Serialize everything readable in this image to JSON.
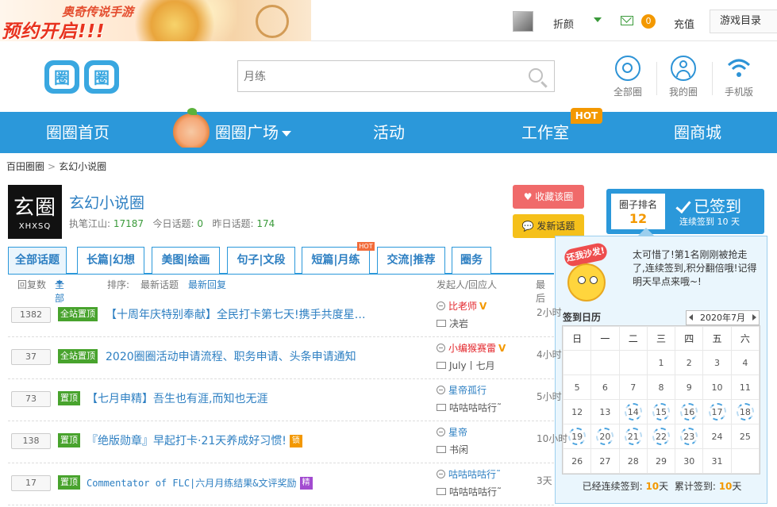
{
  "banner": {
    "line1": "奥奇传说手游",
    "line2": "预约开启!!!"
  },
  "topbar": {
    "username": "折颜",
    "mail_count": "0",
    "recharge": "充值",
    "games_menu": "游戏目录"
  },
  "header": {
    "logo": "圈圈",
    "search_placeholder": "月练",
    "icons": [
      {
        "label": "全部圈",
        "icon": "circle-icon"
      },
      {
        "label": "我的圈",
        "icon": "user-icon"
      },
      {
        "label": "手机版",
        "icon": "wifi-icon"
      }
    ]
  },
  "nav": {
    "items": [
      "圈圈首页",
      "圈圈广场",
      "活动",
      "工作室",
      "圈商城"
    ],
    "hot": "HOT"
  },
  "breadcrumb": [
    "百田圈圈",
    "玄幻小说圈"
  ],
  "circle": {
    "logo_char": "玄圈",
    "logo_en": "XHXSQ",
    "name": "玄幻小说圈",
    "stat1_label": "执笔江山:",
    "stat1_value": "17187",
    "stat2_label": "今日话题:",
    "stat2_value": "0",
    "stat3_label": "昨日话题:",
    "stat3_value": "174",
    "fav_btn": "收藏该圈",
    "post_btn": "发新话题"
  },
  "rank": {
    "title": "圈子排名",
    "value": "12",
    "signed": "已签到",
    "streak": "连续签到  10 天"
  },
  "popup": {
    "sofa_tag": "还我沙发!",
    "message": "太可惜了!第1名刚刚被抢走了,连续签到,积分翻倍哦!记得明天早点来哦~!",
    "cal_title": "签到日历",
    "month": "2020年7月",
    "weekdays": [
      "日",
      "一",
      "二",
      "三",
      "四",
      "五",
      "六"
    ],
    "weeks": [
      [
        "",
        "",
        "",
        "1",
        "2",
        "3",
        "4"
      ],
      [
        "5",
        "6",
        "7",
        "8",
        "9",
        "10",
        "11"
      ],
      [
        "12",
        "13",
        "14",
        "15",
        "16",
        "17",
        "18"
      ],
      [
        "19",
        "20",
        "21",
        "22",
        "23",
        "24",
        "25"
      ],
      [
        "26",
        "27",
        "28",
        "29",
        "30",
        "31",
        ""
      ]
    ],
    "signed_days": [
      "14",
      "15",
      "16",
      "17",
      "18",
      "19",
      "20",
      "21",
      "22",
      "23"
    ],
    "summary_a": "已经连续签到:",
    "summary_a_val": "10",
    "summary_unit": "天",
    "summary_b": "累计签到:",
    "summary_b_val": "10"
  },
  "tabs": [
    "全部话题",
    "长篇|幻想",
    "美图|绘画",
    "句子|文段",
    "短篇|月练",
    "交流|推荐",
    "圈务"
  ],
  "tab_hot": "HOT",
  "list_head": {
    "reply_count": "回复数",
    "all": "全部",
    "sort": "排序:",
    "latest_topic": "最新话题",
    "latest_reply": "最新回复",
    "poster": "发起人/回应人",
    "last": "最后"
  },
  "rows": [
    {
      "count": "1382",
      "tag": "全站置顶",
      "title": "【十周年庆特别奉献】全民打卡第七天!携手共度星…",
      "poster": "比老师",
      "poster_red": true,
      "vip": "V",
      "replier": "决岩",
      "time": "2小时"
    },
    {
      "count": "37",
      "tag": "全站置顶",
      "title": "2020圈圈活动申请流程、职务申请、头条申请通知",
      "poster": "小编猴赛雷",
      "poster_red": true,
      "vip": "V",
      "replier": "July丨七月",
      "time": "4小时"
    },
    {
      "count": "73",
      "tag": "置顶",
      "title": "【七月申精】吾生也有涯,而知也无涯",
      "poster": "星帝孤行",
      "poster_red": false,
      "vip": "",
      "replier": "咕咕咕咕行˜",
      "time": "5小时"
    },
    {
      "count": "138",
      "tag": "置顶",
      "title": "『绝版勋章』早起打卡·21天养成好习惯!",
      "mini": "锁",
      "mini_color": "#f39800",
      "poster": "星帝",
      "poster_red": false,
      "vip": "",
      "replier": "书闲",
      "time": "10小时"
    },
    {
      "count": "17",
      "tag": "置顶",
      "title": "Commentator of FLC|六月月练结果&文评奖励",
      "mini": "精",
      "mini_color": "#a24bd0",
      "mono": true,
      "poster": "咕咕咕咕行˜",
      "poster_red": false,
      "vip": "",
      "replier": "咕咕咕咕行˜",
      "time": "3天"
    }
  ]
}
